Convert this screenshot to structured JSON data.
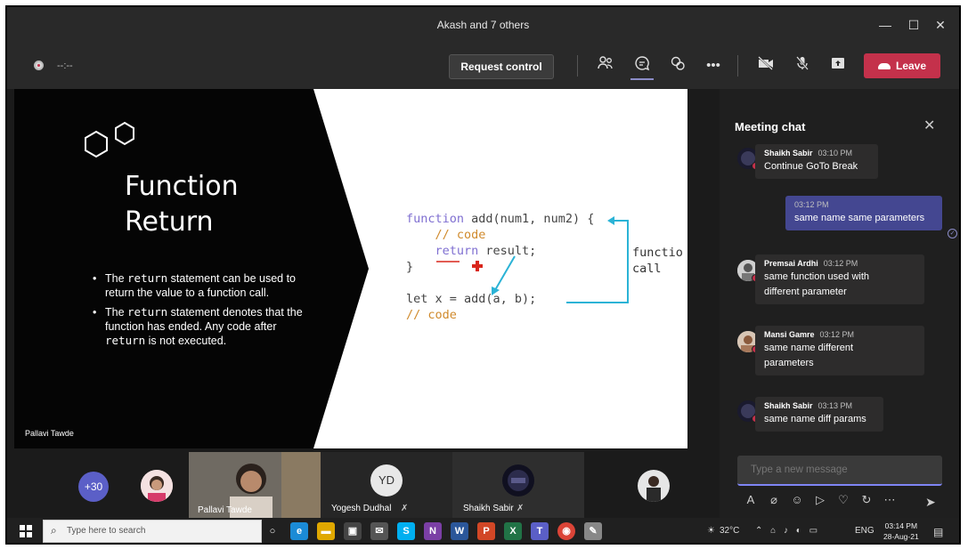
{
  "window": {
    "title": "Akash and 7 others",
    "controls": {
      "minimize": "—",
      "maximize": "☐",
      "close": "✕"
    }
  },
  "toolbar": {
    "timer": "--:--",
    "request_control": "Request control",
    "more": "•••",
    "leave": "Leave"
  },
  "slide": {
    "title_line1": "Function",
    "title_line2": "Return",
    "bullet1_pre": "The ",
    "bullet1_code": "return",
    "bullet1_post": " statement can be used to return the value to a function call.",
    "bullet2_pre": "The ",
    "bullet2_code": "return",
    "bullet2_mid": " statement denotes that the function has ended. Any code after ",
    "bullet2_code2": "return",
    "bullet2_post": " is not executed.",
    "presenter": "Pallavi Tawde",
    "code": {
      "line1_kw": "function",
      "line1_rest": " add(num1, num2) {",
      "line2": "    // code",
      "line3_kw": "    return",
      "line3_rest": " result;",
      "line4": "}",
      "line5": "let x = add(a, b);",
      "line6": "// code"
    },
    "call_label_line1": "functio",
    "call_label_line2": "call"
  },
  "chat": {
    "title": "Meeting chat",
    "messages": [
      {
        "sender": "Shaikh Sabir",
        "time": "03:10 PM",
        "lines": [
          "Continue GoTo Break"
        ]
      },
      {
        "sender": "",
        "time": "03:12 PM",
        "lines": [
          "same name same parameters"
        ]
      },
      {
        "sender": "Premsai Ardhi",
        "time": "03:12 PM",
        "lines": [
          "same function used with",
          "different parameter"
        ]
      },
      {
        "sender": "Mansi Gamre",
        "time": "03:12 PM",
        "lines": [
          "same name different",
          "parameters"
        ]
      },
      {
        "sender": "Shaikh Sabir",
        "time": "03:13 PM",
        "lines": [
          "same name diff params"
        ]
      }
    ],
    "compose_placeholder": "Type a new message"
  },
  "participants": {
    "overflow": "+30",
    "tile_pallavi": "Pallavi Tawde",
    "yd_initials": "YD",
    "tile_yogesh": "Yogesh Dudhal",
    "tile_shaikh": "Shaikh Sabir"
  },
  "taskbar": {
    "search_placeholder": "Type here to search",
    "weather": "32°C",
    "lang": "ENG",
    "time": "03:14 PM",
    "date": "28-Aug-21"
  },
  "colors": {
    "leave": "#c4314b",
    "accent": "#7f85f5",
    "own_message": "#444791",
    "code_keyword": "#7f6fd1",
    "code_comment": "#d08a2c",
    "arrow": "#2bb3d6"
  }
}
